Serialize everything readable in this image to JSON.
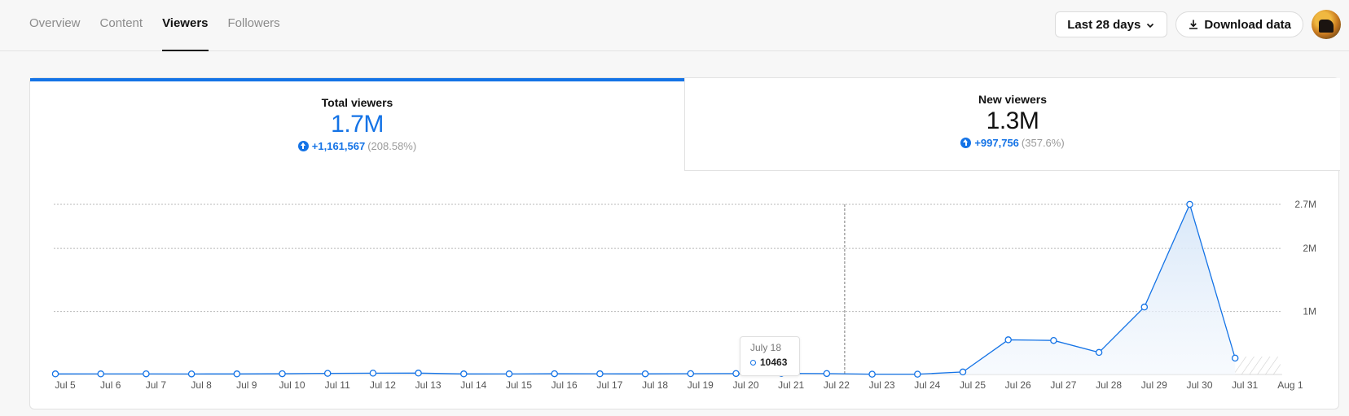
{
  "nav": {
    "tabs": [
      {
        "label": "Overview",
        "active": false
      },
      {
        "label": "Content",
        "active": false
      },
      {
        "label": "Viewers",
        "active": true
      },
      {
        "label": "Followers",
        "active": false
      }
    ]
  },
  "controls": {
    "range_label": "Last 28 days",
    "download_label": "Download data"
  },
  "stats": {
    "total": {
      "title": "Total viewers",
      "value": "1.7M",
      "delta_abs": "+1,161,567",
      "delta_pct": "(208.58%)"
    },
    "new": {
      "title": "New viewers",
      "value": "1.3M",
      "delta_abs": "+997,756",
      "delta_pct": "(357.6%)"
    }
  },
  "tooltip": {
    "date": "July 18",
    "value": "10463"
  },
  "colors": {
    "accent": "#1473e6",
    "area_fill": "#e6f0fb",
    "grid": "#bdbdbd"
  },
  "chart_data": {
    "type": "area",
    "x": [
      "Jul 5",
      "Jul 6",
      "Jul 7",
      "Jul 8",
      "Jul 9",
      "Jul 10",
      "Jul 11",
      "Jul 12",
      "Jul 13",
      "Jul 14",
      "Jul 15",
      "Jul 16",
      "Jul 17",
      "Jul 18",
      "Jul 19",
      "Jul 20",
      "Jul 21",
      "Jul 22",
      "Jul 23",
      "Jul 24",
      "Jul 25",
      "Jul 26",
      "Jul 27",
      "Jul 28",
      "Jul 29",
      "Jul 30",
      "Jul 31",
      "Aug 1"
    ],
    "series": [
      {
        "values": [
          9000,
          9500,
          10000,
          8500,
          9200,
          12000,
          18000,
          21000,
          22000,
          9000,
          9500,
          12000,
          11000,
          10463,
          13000,
          15000,
          18000,
          15000,
          5000,
          5000,
          40000,
          550000,
          540000,
          350000,
          1070000,
          2700000,
          260000,
          null
        ]
      }
    ],
    "yticks": [
      {
        "value": 1000000,
        "label": "1M"
      },
      {
        "value": 2000000,
        "label": "2M"
      },
      {
        "value": 2700000,
        "label": "2.7M"
      }
    ],
    "ylim": [
      0,
      2700000
    ],
    "grid": true,
    "highlight": {
      "index": 13,
      "marker_x": "Jul 22"
    }
  }
}
